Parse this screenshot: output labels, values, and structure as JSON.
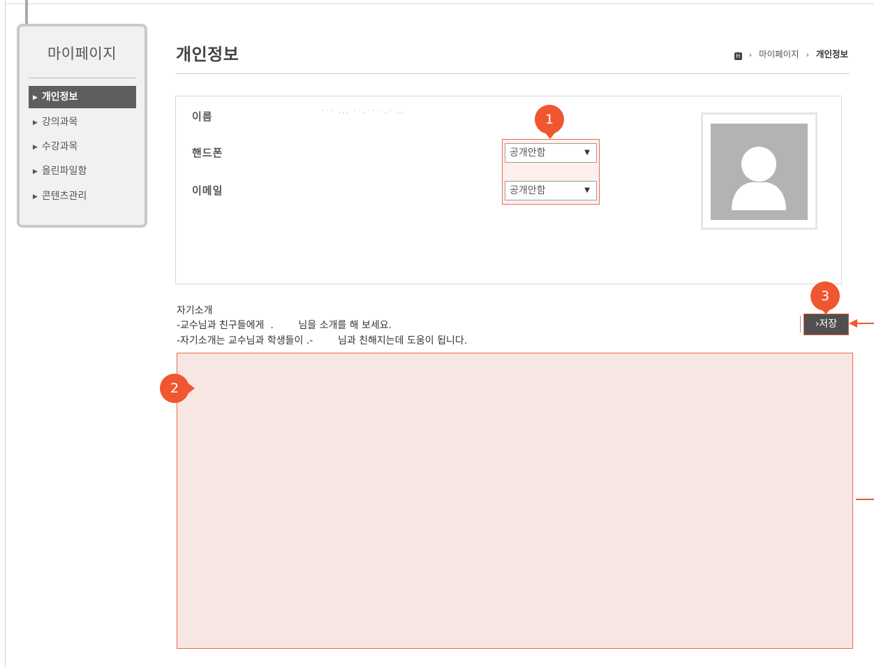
{
  "sidebar": {
    "title": "마이페이지",
    "items": [
      {
        "label": "개인정보",
        "active": true
      },
      {
        "label": "강의과목",
        "active": false
      },
      {
        "label": "수강과목",
        "active": false
      },
      {
        "label": "올린파일함",
        "active": false
      },
      {
        "label": "콘텐츠관리",
        "active": false
      }
    ]
  },
  "header": {
    "title": "개인정보",
    "breadcrumb": {
      "home": "H",
      "parent": "마이페이지",
      "current": "개인정보"
    }
  },
  "profile": {
    "name_label": "이름",
    "name_value": "˙˙˙ ··· ˙˙·˙˙ ˙·˙ ··",
    "phone_label": "핸드폰",
    "phone_visibility": "공개안함",
    "email_label": "이메일",
    "email_visibility": "공개안함"
  },
  "callouts": {
    "one": "1",
    "two": "2",
    "three": "3"
  },
  "intro": {
    "heading": "자기소개",
    "line1": "-교수님과 친구들에게  .        님을 소개를 해 보세요.",
    "line2": "-자기소개는 교수님과 학생들이 .-        님과 친해지는데 도움이 됩니다."
  },
  "actions": {
    "save_label": "저장"
  },
  "colors": {
    "accent": "#f0562f",
    "nav_active": "#5e5e5e",
    "highlight_bg": "#f8e6e3"
  },
  "icons": {
    "home": "home-icon",
    "nav_arrow": "triangle-right-icon",
    "caret": "caret-down-icon",
    "avatar": "user-silhouette-icon"
  }
}
